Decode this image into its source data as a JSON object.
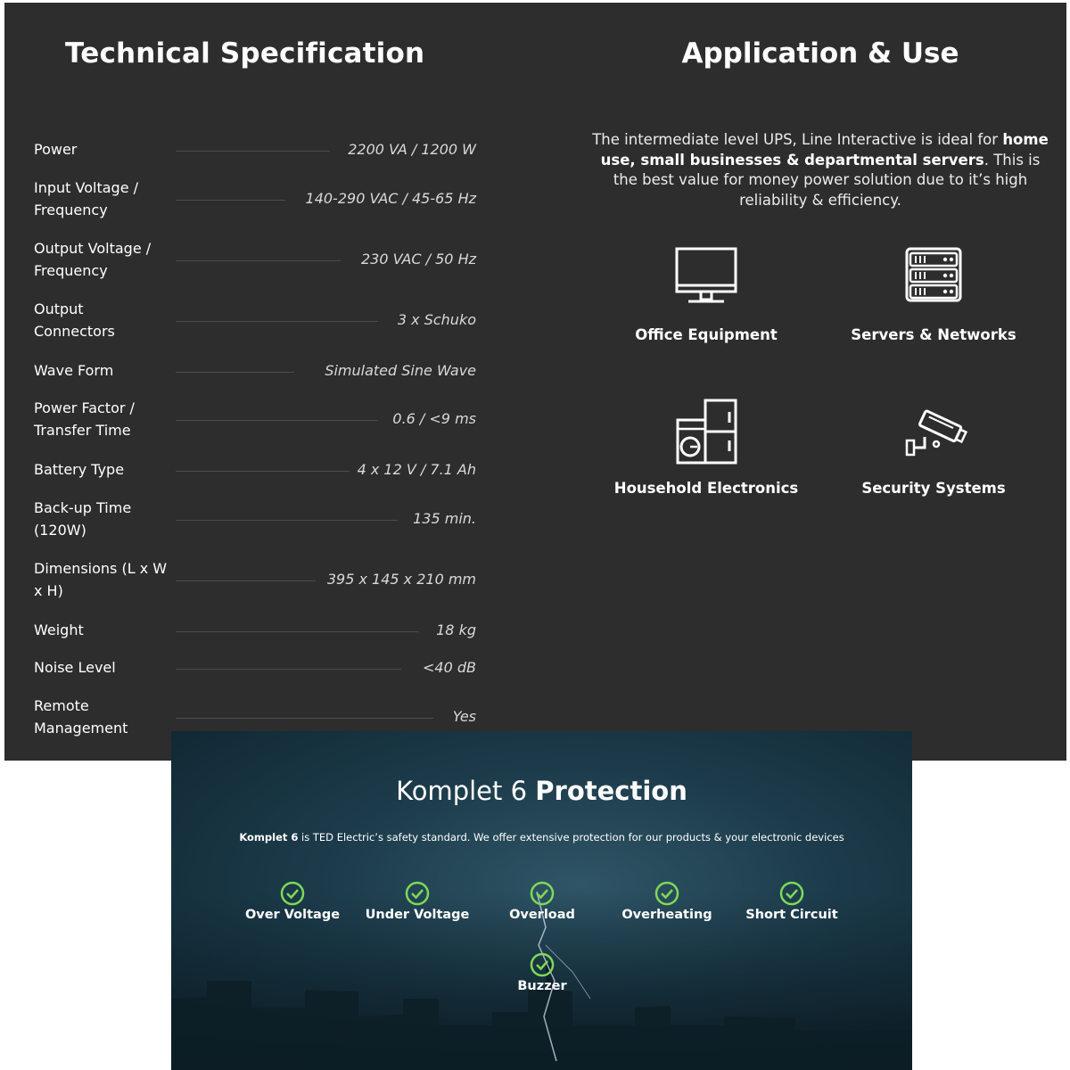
{
  "spec": {
    "title": "Technical Specification",
    "rows": [
      {
        "label": "Power",
        "value": "2200 VA / 1200 W"
      },
      {
        "label": "Input Voltage / Frequency",
        "value": "140-290 VAC / 45-65 Hz"
      },
      {
        "label": "Output Voltage / Frequency",
        "value": "230 VAC / 50 Hz"
      },
      {
        "label": "Output Connectors",
        "value": "3 x Schuko"
      },
      {
        "label": "Wave Form",
        "value": "Simulated Sine Wave"
      },
      {
        "label": "Power Factor / Transfer Time",
        "value": "0.6 / <9 ms"
      },
      {
        "label": "Battery Type",
        "value": "4 x 12 V / 7.1 Ah"
      },
      {
        "label": "Back-up Time (120W)",
        "value": "135 min."
      },
      {
        "label": "Dimensions (L x W x H)",
        "value": "395 x 145 x 210 mm"
      },
      {
        "label": "Weight",
        "value": "18 kg"
      },
      {
        "label": "Noise Level",
        "value": "<40 dB"
      },
      {
        "label": "Remote Management",
        "value": "Yes"
      }
    ]
  },
  "application": {
    "title": "Application & Use",
    "desc_1": "The intermediate level UPS, Line Interactive is ideal for ",
    "desc_bold": "home use, small businesses & departmental servers",
    "desc_2": ". This is the best value for money power solution due to it’s high reliability & efficiency.",
    "uses": [
      {
        "label": "Office Equipment",
        "icon": "monitor-icon"
      },
      {
        "label": "Servers & Networks",
        "icon": "server-rack-icon"
      },
      {
        "label": "Household Electronics",
        "icon": "appliances-icon"
      },
      {
        "label": "Security Systems",
        "icon": "security-camera-icon"
      }
    ]
  },
  "protection": {
    "title_light": "Komplet 6 ",
    "title_bold": "Protection",
    "desc_bold": "Komplet 6",
    "desc_rest": " is TED Electric’s safety standard. We offer extensive protection for our products & your electronic devices",
    "items": [
      "Over Voltage",
      "Under Voltage",
      "Overload",
      "Overheating",
      "Short Circuit",
      "Buzzer"
    ],
    "check_color": "#7ed957"
  }
}
